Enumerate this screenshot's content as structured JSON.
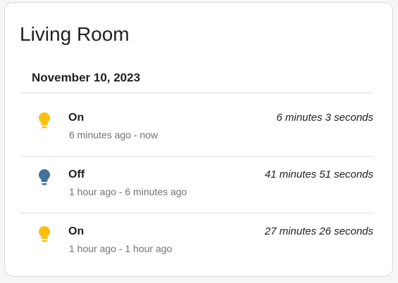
{
  "card": {
    "title": "Living Room",
    "date": "November 10, 2023"
  },
  "colors": {
    "on": "#fdbf0f",
    "off": "#44739e"
  },
  "entries": [
    {
      "icon": "lightbulb-icon",
      "state": "On",
      "time": "6 minutes ago - now",
      "duration": "6 minutes 3 seconds"
    },
    {
      "icon": "lightbulb-icon",
      "state": "Off",
      "time": "1 hour ago - 6 minutes ago",
      "duration": "41 minutes 51 seconds"
    },
    {
      "icon": "lightbulb-icon",
      "state": "On",
      "time": "1 hour ago - 1 hour ago",
      "duration": "27 minutes 26 seconds"
    }
  ]
}
